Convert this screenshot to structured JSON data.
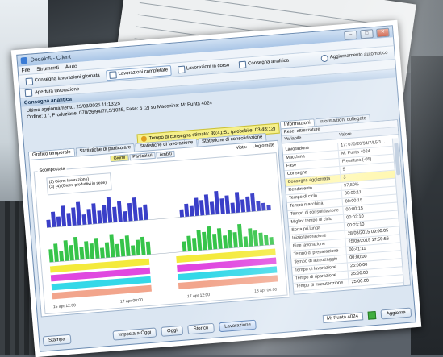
{
  "window": {
    "title": "Dedalo5 - Client"
  },
  "menubar": {
    "items": [
      "File",
      "Strumenti",
      "Aiuto"
    ]
  },
  "toolbar": {
    "items": [
      {
        "label": "Consegna lavorazioni giornata",
        "active": false
      },
      {
        "label": "Lavorazioni completate",
        "active": true
      },
      {
        "label": "Lavorazioni in corso",
        "active": false
      },
      {
        "label": "Consegna analitica",
        "active": false
      }
    ],
    "auto_update": "Aggiornamento automatico"
  },
  "subtoolbar": {
    "label": "Apertura lavorazione"
  },
  "panel": {
    "title": "Consegna analitica",
    "last_update": "Ultimo aggiornamento: 23/08/2025 11:13:25",
    "details": "Ordine: 17, Produzione: 070/26/94/7/L5/1025, Fase: 5 (2) su Macchina: M: Punta 4024",
    "warning": "Tempo di consegna stimato: 30:41:51 (probabile: 03:48:12)"
  },
  "chart_tabs": {
    "tabs": [
      "Grafico temporale",
      "Statistiche di particolare",
      "Statistiche di lavorazione",
      "Statistiche di consolidazione"
    ],
    "selected": 0
  },
  "chart_view": {
    "subtabs": [
      "Giorni",
      "Particolari",
      "Ambiti"
    ],
    "selected_subtab": 0,
    "zoom_label": "Vista:",
    "zoom_value": "Ungiornate",
    "group_label": "Scompostata",
    "legend_lines": [
      "(2) Giorni lavorazione)",
      "(3) (4) (Giorni produttivi in sede)"
    ],
    "colors": {
      "blue": "#3a3fc8",
      "green": "#36c44a",
      "yellow": "#f4ea3c",
      "magenta": "#e048e0",
      "cyan": "#34d8e8",
      "salmon": "#f2a58c"
    }
  },
  "chart_data": {
    "type": "bar",
    "x_tick_labels": [
      "15 apr 12:00",
      "17 apr 00:00",
      "17 apr 12:00",
      "18 apr 00:00"
    ],
    "series": [
      {
        "values": [
          3,
          6,
          4,
          8,
          5,
          7,
          9,
          4,
          6,
          8,
          5,
          7,
          10,
          6,
          8,
          4,
          7,
          9,
          5,
          6,
          0,
          0,
          0,
          0,
          0,
          0,
          3,
          5,
          4,
          7,
          6,
          8,
          5,
          9,
          6,
          7,
          4,
          8,
          5,
          6,
          7,
          4,
          3,
          2
        ]
      },
      {
        "values": [
          5,
          7,
          4,
          8,
          6,
          9,
          5,
          7,
          6,
          8,
          4,
          6,
          9,
          5,
          7,
          8,
          4,
          6,
          7,
          5,
          0,
          0,
          0,
          0,
          0,
          0,
          4,
          6,
          5,
          8,
          7,
          9,
          6,
          8,
          5,
          7,
          6,
          9,
          4,
          7,
          6,
          5,
          4,
          3
        ]
      }
    ],
    "bands": [
      {
        "row": 1,
        "segments": [
          [
            0,
            0.44
          ],
          [
            0.56,
            1.0
          ]
        ]
      },
      {
        "row": 2,
        "segments": [
          [
            0,
            0.44
          ],
          [
            0.56,
            1.0
          ]
        ]
      },
      {
        "row": 3,
        "segments": [
          [
            0,
            0.44
          ],
          [
            0.56,
            1.0
          ]
        ]
      },
      {
        "row": 4,
        "segments": [
          [
            0,
            0.44
          ],
          [
            0.56,
            1.0
          ]
        ]
      }
    ]
  },
  "right_panel": {
    "tabs": [
      "Informazioni",
      "Informazioni collegate"
    ],
    "selected": 0,
    "filter": "Rese: attrezzature",
    "columns": [
      "Variabile",
      "Valore"
    ],
    "rows": [
      {
        "key": "Lavorazione",
        "value": "17: 070/26/94/7/L5/1..."
      },
      {
        "key": "Macchina",
        "value": "M: Punta 4024"
      },
      {
        "key": "Fase",
        "value": "Fresatura (-05)"
      },
      {
        "key": "Consegna",
        "value": "5"
      },
      {
        "key": "Consegna aggiornata",
        "value": "3"
      },
      {
        "key": "Rendimento",
        "value": "97,80%"
      },
      {
        "key": "Tempo di ciclo",
        "value": "00:00:11"
      },
      {
        "key": "Tempo macchina",
        "value": "00:00:15"
      },
      {
        "key": "Tempo di consolidazione",
        "value": "00:00:15"
      },
      {
        "key": "Miglior tempo di ciclo",
        "value": "00:02:10"
      },
      {
        "key": "Sorta pri.lunga",
        "value": "00:23:10"
      },
      {
        "key": "Inizio lavorazione",
        "value": "28/08/2015 09:00:05"
      },
      {
        "key": "Fine lavorazione",
        "value": "25/09/2015 17:55:56"
      },
      {
        "key": "Tempo di preparazione",
        "value": "00:41:11"
      },
      {
        "key": "Tempo di attrezzaggio",
        "value": "00:00:00"
      },
      {
        "key": "Tempo di lavorazione",
        "value": "25:00:00"
      },
      {
        "key": "Tempo di riparazione",
        "value": "25:00:00"
      },
      {
        "key": "Tempo di manutenzione",
        "value": "25:00:00"
      }
    ],
    "selected_row": 4
  },
  "bottom": {
    "print": "Stampa",
    "today_label": "Imposta a Oggi",
    "today": "Oggi",
    "history": "Storico",
    "latest": "Lavorazione",
    "machine_select": "M: Punta 4024",
    "refresh": "Aggiorna"
  }
}
